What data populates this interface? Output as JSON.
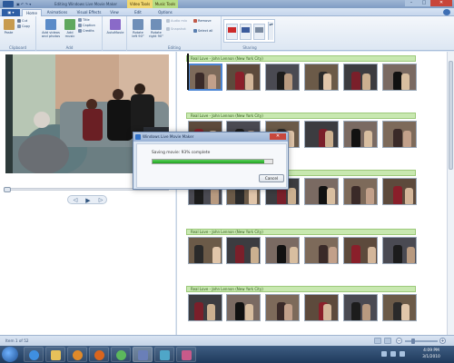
{
  "titlebar": {
    "quick_access": "▣ ↶ ↷ ▾",
    "title": "Editing Windows Live Movie Maker",
    "context_tabs": [
      "Video Tools",
      "Music Tools"
    ],
    "min": "–",
    "max": "□",
    "close": "✕"
  },
  "tabs": {
    "file": "▣ ▾",
    "items": [
      "Home",
      "Animations",
      "Visual Effects",
      "View",
      "Edit",
      "Options"
    ],
    "active": "Home"
  },
  "ribbon": {
    "clipboard": {
      "label": "Clipboard",
      "paste": "Paste",
      "cut": "Cut",
      "copy": "Copy"
    },
    "add": {
      "label": "Add",
      "add_videos": "Add videos and photos",
      "add_music": "Add music",
      "title": "Title",
      "caption": "Caption",
      "credits": "Credits"
    },
    "autoMovie": {
      "label": "AutoMovie"
    },
    "editing": {
      "label": "Editing",
      "rotate_left": "Rotate left 90°",
      "rotate_right": "Rotate right 90°",
      "snapshot": "Snapshot",
      "remove": "Remove",
      "select_all": "Select all",
      "audio_mix": "Audio mix"
    },
    "sharing": {
      "label": "Sharing",
      "items": [
        "YouTube",
        "Facebook",
        "Save"
      ]
    }
  },
  "storyboard": {
    "music_label": "Real Love - John Lennon (New York City)",
    "rows": 5,
    "thumbs_per_row": 6
  },
  "dialog": {
    "title": "Windows Live Movie Maker",
    "message": "Saving movie: 93% complete",
    "progress": 0.93,
    "cancel": "Cancel",
    "close": "✕"
  },
  "player": {
    "prev": "◁",
    "play": "▶",
    "next": "▷"
  },
  "status": {
    "text": "Item 1 of 52",
    "zoom_minus": "−",
    "zoom_plus": "+"
  },
  "taskbar": {
    "time": "4:09 PM",
    "date": "3/1/2010",
    "apps": [
      "Internet Explorer",
      "Windows Explorer",
      "Media Player",
      "Firefox",
      "Messenger",
      "Movie Maker",
      "Photo Gallery",
      "Paint"
    ]
  },
  "colors": {
    "accent": "#2e5fa5",
    "music_bar": "#c8e8b0",
    "progress": "#1fa21f"
  }
}
